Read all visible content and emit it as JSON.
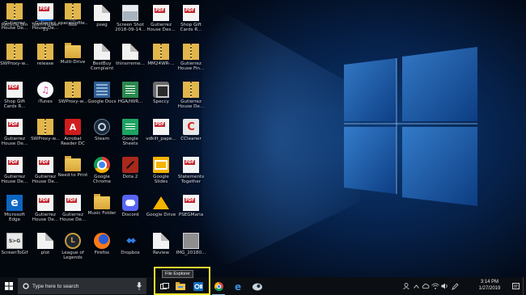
{
  "desktop_icons": [
    {
      "label": "Recycle Bin",
      "icon": "recycle-bin-icon"
    },
    {
      "label": "TeamViewer 13",
      "icon": "teamviewer-icon"
    },
    {
      "label": "Nox",
      "icon": "nox-icon"
    },
    {
      "label": "pseg",
      "icon": "document-icon"
    },
    {
      "label": "Screen Shot 2018-09-14...",
      "icon": "screenshot-icon"
    },
    {
      "label": "Gutierrez House Des...",
      "icon": "pdf-icon"
    },
    {
      "label": "Shop Gift Cards R...",
      "icon": "pdf-icon"
    },
    {
      "label": "SWProxy-w...",
      "icon": "zip-icon"
    },
    {
      "label": "release",
      "icon": "zip-icon"
    },
    {
      "label": "Multi-Drive",
      "icon": "folder-icon"
    },
    {
      "label": "BestBuy Complaint",
      "icon": "document-icon"
    },
    {
      "label": "thinsrreme...",
      "icon": "document-icon"
    },
    {
      "label": "MM24WR-...",
      "icon": "zip-icon"
    },
    {
      "label": "Gutierrez House Fin...",
      "icon": "zip-icon"
    },
    {
      "label": "Shop Gift Cards R...",
      "icon": "pdf-icon"
    },
    {
      "label": "iTunes",
      "icon": "itunes-icon"
    },
    {
      "label": "SWProxy-w...",
      "icon": "zip-icon"
    },
    {
      "label": "Google Docs",
      "icon": "google-docs-icon"
    },
    {
      "label": "HGA/IWR...",
      "icon": "spreadsheet-icon"
    },
    {
      "label": "Speccy",
      "icon": "speccy-icon"
    },
    {
      "label": "Gutierrez House De...",
      "icon": "zip-icon"
    },
    {
      "label": "Gutierrez House De...",
      "icon": "pdf-icon"
    },
    {
      "label": "SWProxy-w...",
      "icon": "zip-icon"
    },
    {
      "label": "Acrobat Reader DC",
      "icon": "acrobat-icon"
    },
    {
      "label": "Steam",
      "icon": "steam-icon"
    },
    {
      "label": "Google Sheets",
      "icon": "google-sheets-icon"
    },
    {
      "label": "vdkilt_pape...",
      "icon": "pdf-icon"
    },
    {
      "label": "CCleaner",
      "icon": "ccleaner-icon"
    },
    {
      "label": "Gutierrez House De...",
      "icon": "pdf-icon"
    },
    {
      "label": "Gutierrez House De...",
      "icon": "pdf-icon"
    },
    {
      "label": "Need to Print",
      "icon": "folder-icon"
    },
    {
      "label": "Google Chrome",
      "icon": "chrome-icon"
    },
    {
      "label": "Dota 2",
      "icon": "dota-icon"
    },
    {
      "label": "Google Slides",
      "icon": "google-slides-icon"
    },
    {
      "label": "Statements Together",
      "icon": "pdf-icon"
    },
    {
      "label": "Microsoft Edge",
      "icon": "edge-icon"
    },
    {
      "label": "Gutierrez House De...",
      "icon": "pdf-icon"
    },
    {
      "label": "Gutierrez House De...",
      "icon": "pdf-icon"
    },
    {
      "label": "Music Folder",
      "icon": "folder-icon"
    },
    {
      "label": "Discord",
      "icon": "discord-icon"
    },
    {
      "label": "Google Drive",
      "icon": "google-drive-icon"
    },
    {
      "label": "PSEGMaria",
      "icon": "pdf-icon"
    },
    {
      "label": "ScreenToGif",
      "icon": "screentogif-icon"
    },
    {
      "label": "plot",
      "icon": "document-icon"
    },
    {
      "label": "League of Legends",
      "icon": "league-icon"
    },
    {
      "label": "Firefox",
      "icon": "firefox-icon"
    },
    {
      "label": "Dropbox",
      "icon": "dropbox-icon"
    },
    {
      "label": "Review",
      "icon": "document-icon"
    },
    {
      "label": "IMG_20180...",
      "icon": "image-icon"
    },
    {
      "label": "Gutierrez House De...",
      "icon": "zip-icon"
    },
    {
      "label": "Gutierrez House De...",
      "icon": "pdf-icon"
    },
    {
      "label": "spacesinfile...",
      "icon": "zip-icon"
    }
  ],
  "taskbar": {
    "search_placeholder": "Type here to search",
    "tooltip": "File Explorer",
    "pinned": [
      {
        "name": "task-view-icon",
        "active": false
      },
      {
        "name": "file-explorer-icon",
        "active": false
      },
      {
        "name": "outlook-icon",
        "active": false
      },
      {
        "name": "chrome-icon",
        "active": true
      },
      {
        "name": "edge-icon",
        "active": false
      },
      {
        "name": "steam-icon",
        "active": false
      }
    ],
    "tray_icons": [
      "people-icon",
      "chevron-up-icon",
      "cloud-icon",
      "wifi-icon",
      "volume-icon",
      "pen-icon"
    ],
    "time": "3:14 PM",
    "date": "1/27/2019"
  },
  "colors": {
    "highlight": "#ede62f",
    "taskbar": "#0b0e12",
    "wallpaper_glow": "#0c3b78"
  }
}
